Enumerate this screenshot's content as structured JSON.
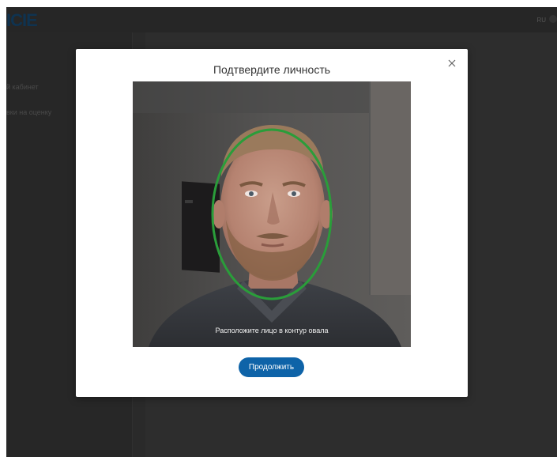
{
  "app": {
    "logo_text": "ICIE",
    "lang_text": "RU",
    "sidebar": {
      "items": [
        {
          "label": "й кабинет"
        },
        {
          "label": "вки на оценку"
        }
      ]
    }
  },
  "modal": {
    "title": "Подтвердите личность",
    "close_icon": "close-icon",
    "camera_hint": "Расположите лицо в контур овала",
    "continue_label": "Продолжить"
  },
  "colors": {
    "accent": "#0e63a8",
    "oval": "#2a9d3a",
    "overlay_bg": "#2b2b2b"
  }
}
